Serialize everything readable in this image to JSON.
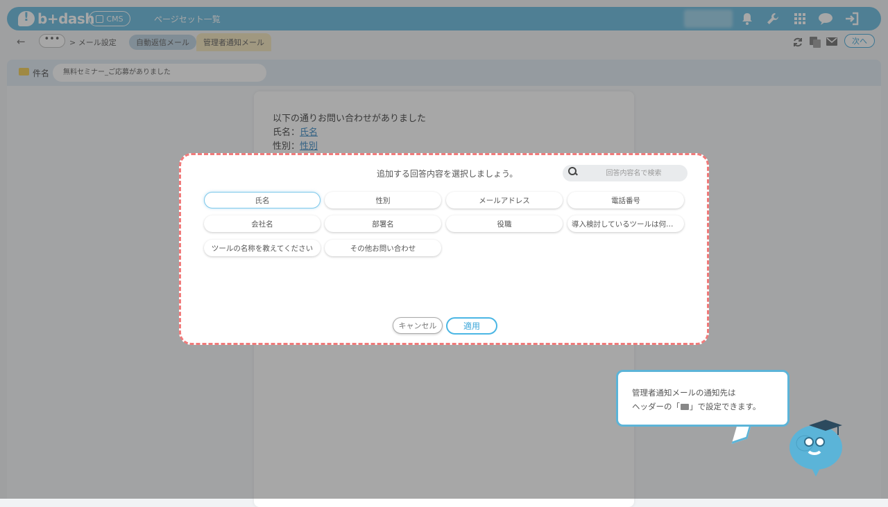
{
  "header": {
    "brand": "b+dash",
    "cms_label": "CMS",
    "pageset_link": "ページセット一覧",
    "icons": [
      "bell-icon",
      "wrench-icon",
      "grid-icon",
      "chat-icon",
      "logout-icon"
    ]
  },
  "subbar": {
    "back_icon": "←",
    "more": "•••",
    "breadcrumb": "> メール設定",
    "tabs": [
      "自動返信メール",
      "管理者通知メール"
    ],
    "icons": [
      "refresh-icon",
      "copy-icon",
      "mail-settings-icon"
    ],
    "next_label": "次へ"
  },
  "subject": {
    "label": "件名",
    "value": "無料セミナー_ご応募がありました"
  },
  "mail_body": {
    "line1": "以下の通りお問い合わせがありました",
    "name_prefix": "氏名：",
    "name_var": "氏名",
    "gender_prefix": "性別：",
    "gender_var": "性別"
  },
  "modal": {
    "title": "追加する回答内容を選択しましょう。",
    "search_placeholder": "回答内容名で検索",
    "chips": [
      "氏名",
      "性別",
      "メールアドレス",
      "電話番号",
      "会社名",
      "部署名",
      "役職",
      "導入検討しているツールは何で…",
      "ツールの名称を教えてください",
      "その他お問い合わせ"
    ],
    "cancel_label": "キャンセル",
    "apply_label": "適用"
  },
  "tooltip": {
    "line1": "管理者通知メールの通知先は",
    "line2_pre": "ヘッダーの「",
    "line2_post": "」で設定できます。"
  },
  "colors": {
    "header_blue": "#5fb7dd",
    "accent_blue": "#3aa5d8",
    "highlight_dash": "#f07a7a",
    "admin_tab": "#f3e3b8"
  }
}
